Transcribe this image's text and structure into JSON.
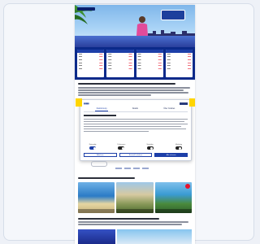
{
  "dialog": {
    "tabs": [
      "Zustimmung",
      "Details",
      "Über Cookies"
    ],
    "toggle_labels": [
      "Notwendig",
      "Präferenzen",
      "Statistiken",
      "Marketing"
    ],
    "toggle_states": [
      true,
      false,
      false,
      false
    ],
    "buttons": [
      "Ablehnen",
      "Auswahl erlauben",
      "Alle zulassen"
    ]
  },
  "colors": {
    "brand_blue": "#0b2a8a",
    "accent_yellow": "#ffd500",
    "price_red": "#e6142d"
  }
}
